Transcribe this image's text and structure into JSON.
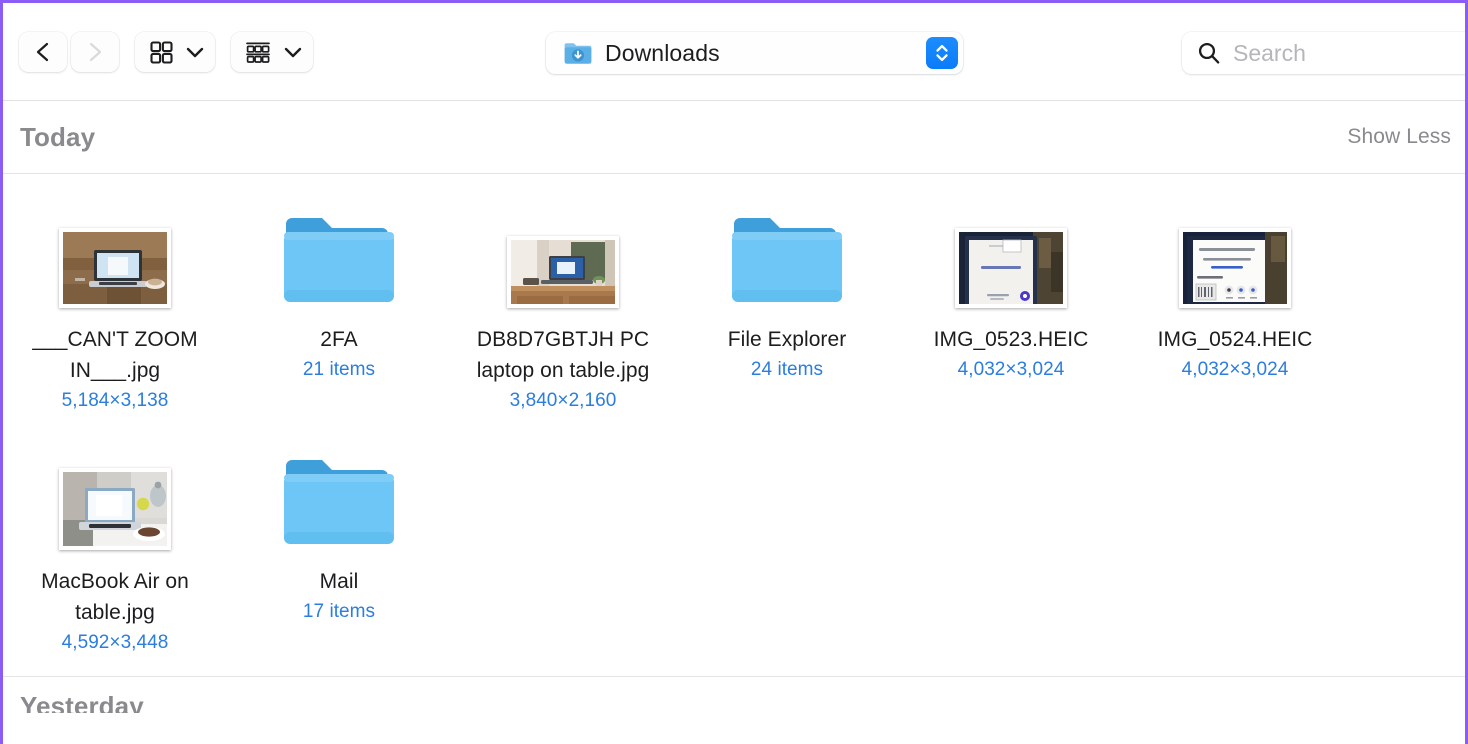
{
  "window": {
    "accent_border_color": "#8b5cf6",
    "background": "#ffffff"
  },
  "toolbar": {
    "back_button": {
      "label": "Back",
      "icon": "chevron-left-icon",
      "enabled": true
    },
    "forward_button": {
      "label": "Forward",
      "icon": "chevron-right-icon",
      "enabled": false
    },
    "view_mode_button": {
      "label": "Icon View",
      "icon": "grid-view-icon",
      "menu_icon": "chevron-down-icon"
    },
    "group_by_button": {
      "label": "Group By",
      "icon": "group-by-icon",
      "menu_icon": "chevron-down-icon"
    },
    "path_popup": {
      "label": "Downloads",
      "icon": "downloads-folder-icon",
      "stepper_icon": "up-down-chevron-icon",
      "stepper_color": "#0a7cf7"
    },
    "search": {
      "placeholder": "Search",
      "value": "",
      "icon": "search-icon"
    }
  },
  "groups": [
    {
      "title": "Today",
      "action_label": "Show Less",
      "rows": [
        [
          {
            "name": "___CAN'T ZOOM IN___.jpg",
            "meta": "5,184×3,138",
            "kind": "image",
            "thumb": "laptop-on-wooden-table-thumbnail"
          },
          {
            "name": "2FA",
            "meta": "21 items",
            "kind": "folder",
            "thumb": "blue-folder-icon"
          },
          {
            "name": "DB8D7GBTJH PC laptop on table.jpg",
            "meta": "3,840×2,160",
            "kind": "image",
            "thumb": "pc-laptop-on-desk-thumbnail"
          },
          {
            "name": "File Explorer",
            "meta": "24 items",
            "kind": "folder",
            "thumb": "blue-folder-icon"
          },
          {
            "name": "IMG_0523.HEIC",
            "meta": "4,032×3,024",
            "kind": "image",
            "thumb": "tablet-screen-photo-thumbnail"
          },
          {
            "name": "IMG_0524.HEIC",
            "meta": "4,032×3,024",
            "kind": "image",
            "thumb": "tablet-dialog-photo-thumbnail"
          }
        ],
        [
          {
            "name": "MacBook Air on table.jpg",
            "meta": "4,592×3,448",
            "kind": "image",
            "thumb": "macbook-air-on-table-thumbnail"
          },
          {
            "name": "Mail",
            "meta": "17 items",
            "kind": "folder",
            "thumb": "blue-folder-icon"
          }
        ]
      ]
    },
    {
      "title": "Yesterday",
      "action_label": "",
      "rows": []
    }
  ],
  "colors": {
    "folder_front": "#6dc6f5",
    "folder_back": "#3f9fdb",
    "meta_text": "#2b7de0",
    "group_text": "#8a8a8e",
    "filename_text": "#1d1d1f"
  }
}
